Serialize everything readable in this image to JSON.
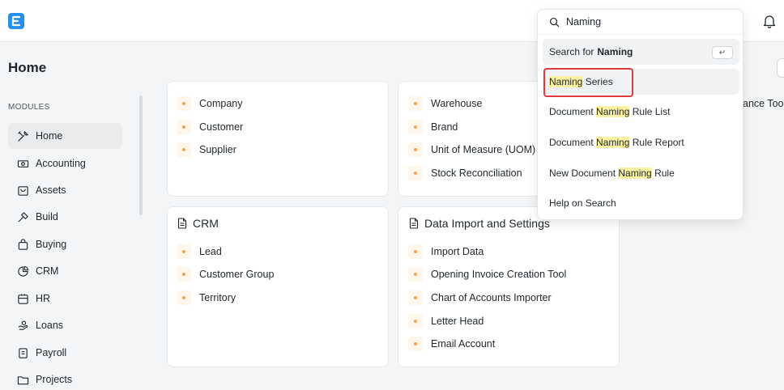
{
  "page": {
    "title": "Home"
  },
  "sidebar": {
    "section_label": "MODULES",
    "items": [
      {
        "label": "Home",
        "icon": "tools-icon"
      },
      {
        "label": "Accounting",
        "icon": "accounting-icon"
      },
      {
        "label": "Assets",
        "icon": "assets-icon"
      },
      {
        "label": "Build",
        "icon": "build-icon"
      },
      {
        "label": "Buying",
        "icon": "buying-icon"
      },
      {
        "label": "CRM",
        "icon": "crm-icon"
      },
      {
        "label": "HR",
        "icon": "hr-icon"
      },
      {
        "label": "Loans",
        "icon": "loans-icon"
      },
      {
        "label": "Payroll",
        "icon": "payroll-icon"
      },
      {
        "label": "Projects",
        "icon": "projects-icon"
      }
    ]
  },
  "cards": {
    "card1": {
      "links": [
        "Company",
        "Customer",
        "Supplier"
      ]
    },
    "card2": {
      "links": [
        "Warehouse",
        "Brand",
        "Unit of Measure (UOM)",
        "Stock Reconciliation"
      ]
    },
    "crm": {
      "title": "CRM",
      "links": [
        "Lead",
        "Customer Group",
        "Territory"
      ]
    },
    "data_import": {
      "title": "Data Import and Settings",
      "links": [
        "Import Data",
        "Opening Invoice Creation Tool",
        "Chart of Accounts Importer",
        "Letter Head",
        "Email Account"
      ]
    }
  },
  "right_partial_text": "ance Tool",
  "search": {
    "query": "Naming",
    "search_for_prefix": "Search for",
    "search_for_term": "Naming",
    "enter_key": "↵",
    "results": [
      {
        "pre": "",
        "match": "Naming",
        "post": " Series"
      },
      {
        "pre": "Document ",
        "match": "Naming",
        "post": " Rule List"
      },
      {
        "pre": "Document ",
        "match": "Naming",
        "post": " Rule Report"
      },
      {
        "pre": "New Document ",
        "match": "Naming",
        "post": " Rule"
      }
    ],
    "help": "Help on Search"
  },
  "colors": {
    "accent": "#2490ef",
    "highlight": "#fcf2a3",
    "bullet": "#f0a550",
    "annotation": "#e23b3b"
  }
}
